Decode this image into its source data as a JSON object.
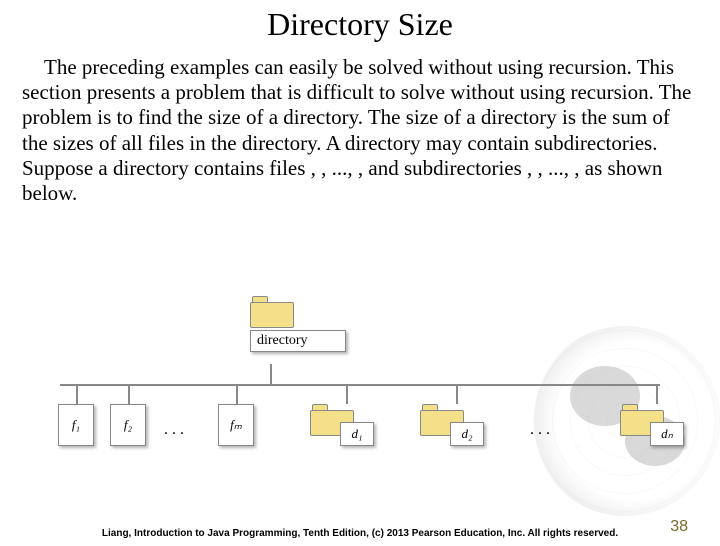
{
  "title": "Directory Size",
  "paragraph": "The preceding examples can easily be solved without using recursion. This section presents a problem that is difficult to solve without using recursion. The problem is to find the size of a directory. The size of a directory is the sum of the sizes of all files in the directory. A directory  may contain subdirectories. Suppose a directory contains files , , ..., , and subdirectories , , ..., , as shown below.",
  "diagram": {
    "root_label": "directory",
    "files": {
      "f1": "f₁",
      "f2": "f₂",
      "fm": "fₘ"
    },
    "dirs": {
      "d1": "d₁",
      "d2": "d₂",
      "dn": "dₙ"
    },
    "ellipsis": ". . ."
  },
  "footer": "Liang, Introduction to Java Programming, Tenth Edition, (c) 2013 Pearson Education, Inc. All rights reserved.",
  "page_number": "38"
}
